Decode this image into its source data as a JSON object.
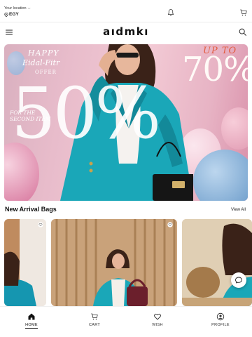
{
  "location": {
    "label": "Your location",
    "value": "EGY"
  },
  "header": {
    "logo": "aıdmkı"
  },
  "banner": {
    "happy": "HAPPY",
    "eid_fitr": "Eidal-Fitr",
    "offer": "OFFER",
    "big_discount": "50%",
    "second_item": "FOR THE\nSECOND ITEM",
    "up_to": "UP TO",
    "up_to_discount": "70%"
  },
  "section": {
    "title": "New Arrival Bags",
    "view_all": "View All"
  },
  "nav": {
    "home": "HOME",
    "cart": "CART",
    "wish": "WISH",
    "profile": "PROFILE"
  },
  "colors": {
    "brand_teal": "#1aa7b8",
    "banner_pink": "#f2c9d4",
    "accent_orange": "#e35b3f"
  },
  "icons": {
    "bell": "bell-icon",
    "cart": "cart-icon",
    "menu": "menu-icon",
    "search": "search-icon",
    "chat": "chat-icon",
    "home": "home-icon",
    "wish": "heart-icon",
    "profile": "profile-icon"
  }
}
